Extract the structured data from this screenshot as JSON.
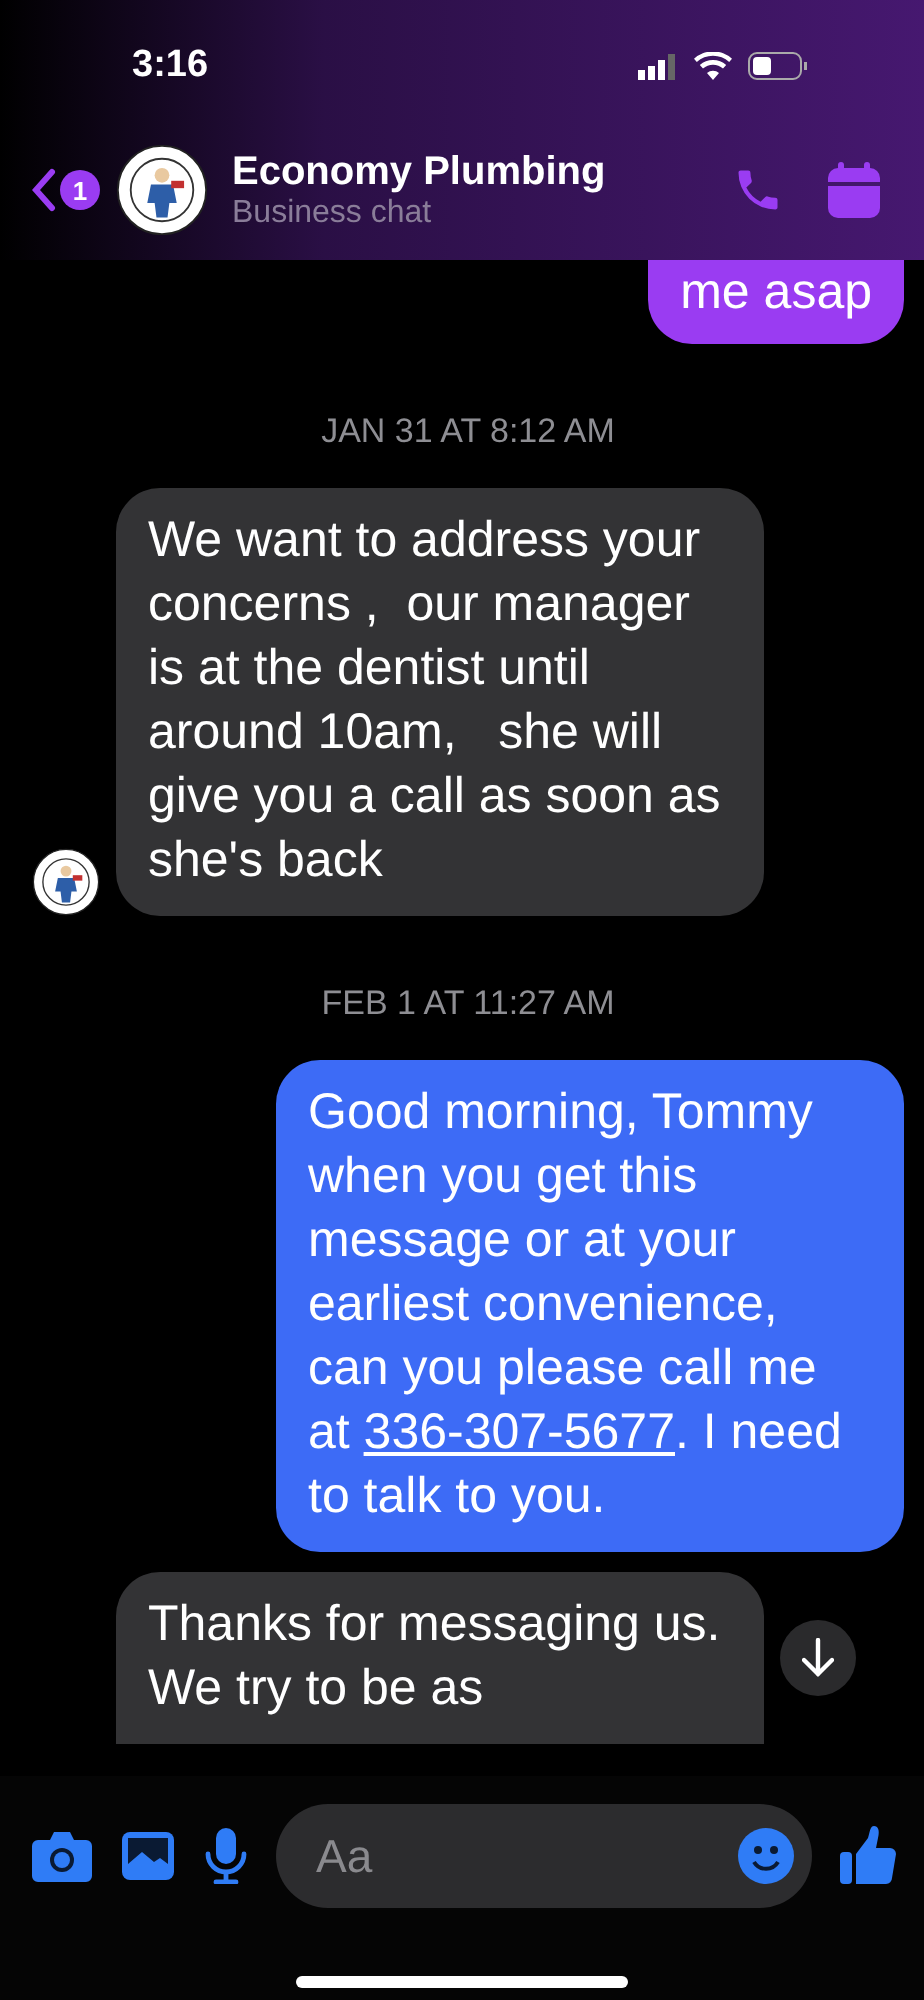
{
  "status_bar": {
    "time": "3:16"
  },
  "header": {
    "back_badge": "1",
    "title": "Economy Plumbing",
    "subtitle": "Business chat"
  },
  "messages": [
    {
      "kind": "outgoing",
      "color": "#9a3cf2",
      "clipped_top": true,
      "show_avatar": false,
      "segments": [
        {
          "kind": "text",
          "text": "me asap"
        }
      ]
    },
    {
      "kind": "timestamp",
      "text": "JAN 31 AT 8:12 AM"
    },
    {
      "kind": "incoming",
      "color": "#333335",
      "clipped_top": false,
      "show_avatar": true,
      "segments": [
        {
          "kind": "text",
          "text": "We want to address your concerns ,  our manager is at the dentist until around 10am,   she will give you a call as soon as she's back"
        }
      ]
    },
    {
      "kind": "timestamp",
      "text": "FEB 1 AT 11:27 AM"
    },
    {
      "kind": "outgoing",
      "color": "#3d6bf6",
      "clipped_top": false,
      "show_avatar": false,
      "segments": [
        {
          "kind": "text",
          "text": "Good morning, Tommy when you get this message or at your earliest convenience, can you please call me at "
        },
        {
          "kind": "link",
          "text": "336-307-5677"
        },
        {
          "kind": "text",
          "text": ". I need to talk to you."
        }
      ]
    },
    {
      "kind": "incoming",
      "color": "#333335",
      "clipped_top": false,
      "show_avatar": false,
      "segments": [
        {
          "kind": "text",
          "text": "Thanks for messaging us. We try to be as"
        }
      ]
    }
  ],
  "composer": {
    "placeholder": "Aa"
  }
}
